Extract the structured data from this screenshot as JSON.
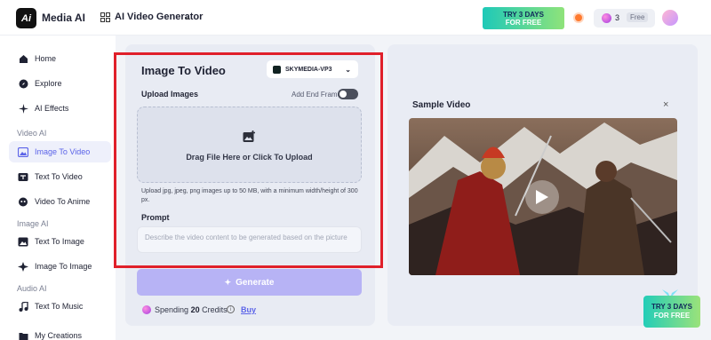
{
  "header": {
    "logo_text": "Ai",
    "brand": "Media AI",
    "generator_label": "AI Video Generator",
    "promo_line1": "TRY 3 DAYS",
    "promo_line2": "FOR FREE",
    "credits": "3",
    "plan_badge": "Free"
  },
  "sidebar": {
    "items": [
      {
        "label": "Home",
        "icon": "home-icon"
      },
      {
        "label": "Explore",
        "icon": "compass-icon"
      },
      {
        "label": "AI Effects",
        "icon": "sparkle-icon"
      }
    ],
    "section_video": "Video AI",
    "video_items": [
      {
        "label": "Image To Video",
        "icon": "image-video-icon",
        "active": true
      },
      {
        "label": "Text To Video",
        "icon": "text-video-icon"
      },
      {
        "label": "Video To Anime",
        "icon": "anime-icon"
      }
    ],
    "section_image": "Image AI",
    "image_items": [
      {
        "label": "Text To Image",
        "icon": "text-image-icon"
      },
      {
        "label": "Image To Image",
        "icon": "image-image-icon"
      }
    ],
    "section_audio": "Audio AI",
    "audio_items": [
      {
        "label": "Text To Music",
        "icon": "music-icon"
      }
    ],
    "bottom_item": {
      "label": "My Creations",
      "icon": "folder-icon"
    }
  },
  "main": {
    "title": "Image To Video",
    "model": "SKYMEDIA-VP3",
    "upload_label": "Upload Images",
    "end_frame_label": "Add End Frame",
    "end_frame_on": false,
    "drop_text": "Drag File Here or Click To Upload",
    "upload_hint": "Upload jpg, jpeg, png images up to 50 MB, with a minimum width/height of 300 px.",
    "prompt_label": "Prompt",
    "prompt_placeholder": "Describe the video content to be generated based on the picture",
    "generate_label": "Generate",
    "spending_prefix": "Spending",
    "spending_amount": "20",
    "spending_suffix": "Credits",
    "buy_label": "Buy"
  },
  "sample": {
    "title": "Sample Video",
    "close": "×"
  },
  "promo_badge": {
    "line1": "TRY 3 DAYS",
    "line2": "FOR FREE"
  },
  "colors": {
    "accent": "#5b63e8",
    "generate_bg": "#b7b3f5",
    "highlight": "#e0202a"
  }
}
